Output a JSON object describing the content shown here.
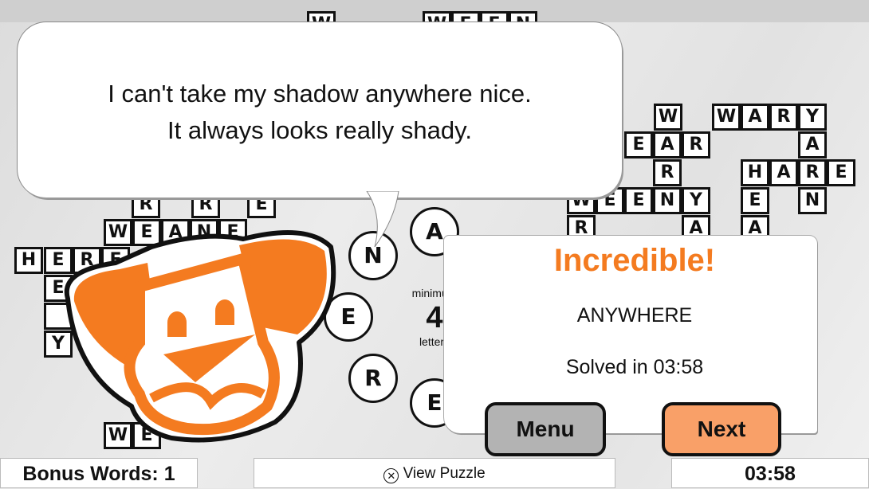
{
  "dialogue": {
    "line1": "I can't take my shadow anywhere nice.",
    "line2": "It always looks really shady."
  },
  "grid_letters": {
    "top": [
      "W",
      "W",
      "E",
      "E",
      "N"
    ],
    "left_top": [
      "R",
      "R",
      "E"
    ],
    "weane": [
      "W",
      "E",
      "A",
      "N",
      "E"
    ],
    "here": [
      "H",
      "E",
      "R",
      "E"
    ],
    "col": [
      "E",
      "",
      "",
      "Y"
    ],
    "bottom": [
      "W",
      "E"
    ],
    "w": [
      "W"
    ],
    "wary": [
      "W",
      "A",
      "R",
      "Y"
    ],
    "ear": [
      "E",
      "A",
      "R"
    ],
    "a1": [
      "A"
    ],
    "r1": [
      "R"
    ],
    "hare": [
      "H",
      "A",
      "R",
      "E"
    ],
    "weeny": [
      "W",
      "E",
      "E",
      "N",
      "Y"
    ],
    "e1": [
      "E"
    ],
    "n1": [
      "N"
    ],
    "row6": [
      "R",
      "A",
      "A"
    ]
  },
  "letter_wheel": [
    "N",
    "A",
    "E",
    "R",
    "E"
  ],
  "minimum": {
    "top": "minimum",
    "value": "4",
    "bottom": "letters"
  },
  "result": {
    "title": "Incredible!",
    "word": "ANYWHERE",
    "solved": "Solved in 03:58"
  },
  "buttons": {
    "menu": "Menu",
    "next": "Next"
  },
  "footer": {
    "bonus": "Bonus Words: 1",
    "view_icon": "x-button-icon",
    "view": "View Puzzle",
    "timer": "03:58"
  },
  "colors": {
    "accent": "#f47b20",
    "next_button": "#f9a068",
    "menu_button": "#b3b3b3"
  }
}
